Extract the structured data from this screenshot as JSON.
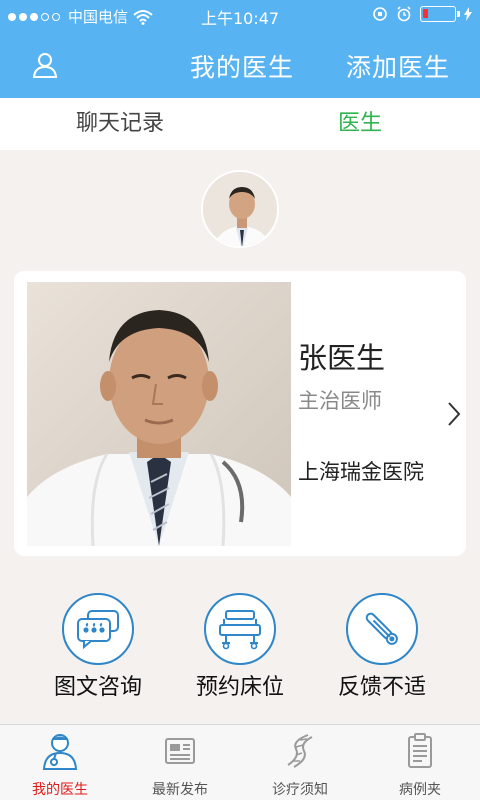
{
  "status_bar": {
    "carrier": "中国电信",
    "time": "上午10:47",
    "signal_bars_filled": 3,
    "signal_bars_total": 5,
    "battery_level": 0.18
  },
  "header": {
    "title": "我的医生",
    "add_label": "添加医生",
    "user_icon": "user-icon"
  },
  "tabs": [
    {
      "label": "聊天记录",
      "active": false
    },
    {
      "label": "医生",
      "active": true
    }
  ],
  "doctor": {
    "name": "张医生",
    "title": "主治医师",
    "hospital": "上海瑞金医院"
  },
  "actions": [
    {
      "label": "图文咨询",
      "icon": "chat-bubbles-icon"
    },
    {
      "label": "预约床位",
      "icon": "hospital-bed-icon"
    },
    {
      "label": "反馈不适",
      "icon": "thermometer-icon"
    }
  ],
  "bottom_nav": [
    {
      "label": "我的医生",
      "icon": "doctor-icon",
      "active": true
    },
    {
      "label": "最新发布",
      "icon": "newspaper-icon",
      "active": false
    },
    {
      "label": "诊疗须知",
      "icon": "dna-icon",
      "active": false
    },
    {
      "label": "病例夹",
      "icon": "clipboard-icon",
      "active": false
    }
  ],
  "colors": {
    "primary": "#58b3f3",
    "active_tab": "#2fb44f",
    "active_nav": "#e21a1a",
    "icon_blue": "#2f86c8",
    "background": "#f4f1ef"
  }
}
